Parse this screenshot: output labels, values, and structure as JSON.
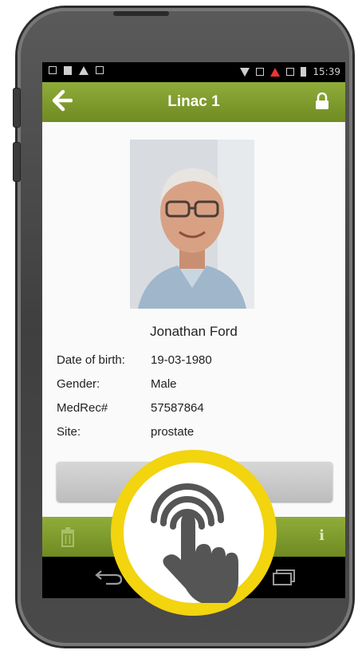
{
  "status_bar": {
    "time": "15:39"
  },
  "app_bar": {
    "title": "Linac 1",
    "back_icon": "arrow-left-icon",
    "lock_icon": "lock-icon"
  },
  "patient": {
    "name": "Jonathan Ford",
    "fields": [
      {
        "label": "Date of birth:",
        "value": "19-03-1980"
      },
      {
        "label": "Gender:",
        "value": "Male"
      },
      {
        "label": "MedRec#",
        "value": "57587864"
      },
      {
        "label": "Site:",
        "value": "prostate"
      }
    ]
  },
  "toolbar": {
    "delete_icon": "trash-icon",
    "info_icon": "info-icon",
    "info_text": "i"
  },
  "colors": {
    "accent": "#7f9b2d",
    "touch_ring": "#f2d40f",
    "hand": "#555555"
  }
}
